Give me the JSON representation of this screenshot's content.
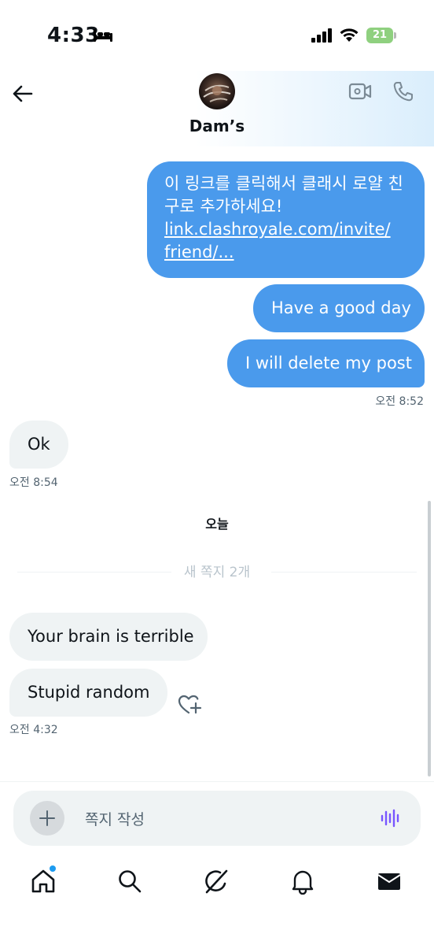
{
  "status_bar": {
    "time": "4:33",
    "battery": "21"
  },
  "header": {
    "contact_name": "Dam’s"
  },
  "messages": {
    "sent_link_line1": "이 링크를 클릭해서 클래시 로얄 친",
    "sent_link_line2": "구로 추가하세요!",
    "sent_link_url1": "link.clashroyale.com/invite/",
    "sent_link_url2": "friend/...",
    "sent_2": "Have a good day",
    "sent_3": "I will delete my post",
    "sent_time": "오전 8:52",
    "recv_1": "Ok",
    "recv_1_time": "오전 8:54",
    "day_label": "오늘",
    "new_messages_label": "새 쪽지 2개",
    "recv_2": "Your brain is terrible",
    "recv_3": "Stupid random",
    "recv_3_time": "오전 4:32"
  },
  "composer": {
    "placeholder": "쪽지 작성"
  },
  "nav": [
    "home",
    "search",
    "grok",
    "notifications",
    "messages"
  ],
  "colors": {
    "sent_bubble": "#4a9aec",
    "recv_bubble": "#eff3f4",
    "accent": "#1d9bf0",
    "voice": "#7856ff"
  }
}
